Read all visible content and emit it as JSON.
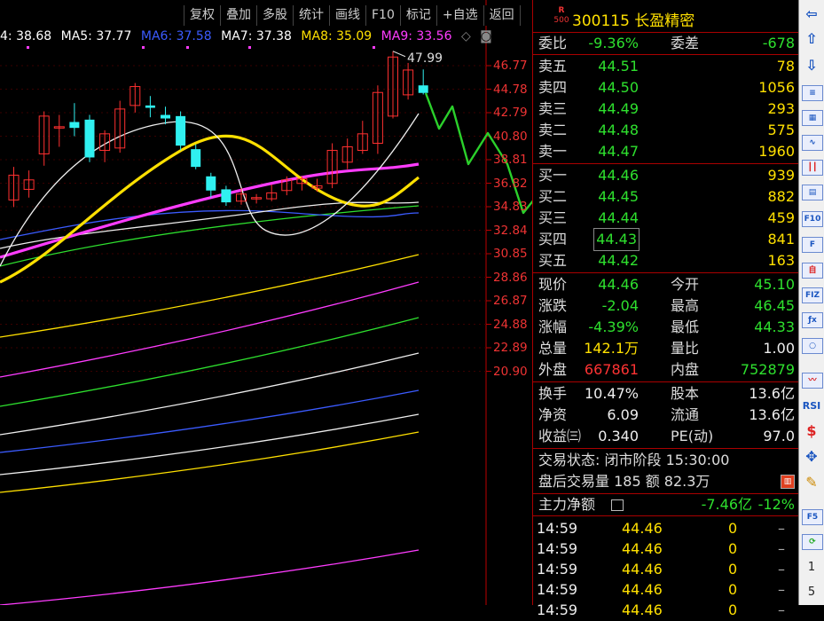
{
  "toolbar": [
    "复权",
    "叠加",
    "多股",
    "统计",
    "画线",
    "F10",
    "标记",
    "+自选",
    "返回"
  ],
  "ma_legend": [
    {
      "label": "4: 38.68",
      "color": "#ffffff"
    },
    {
      "label": "MA5: 37.77",
      "color": "#ffffff"
    },
    {
      "label": "MA6: 37.58",
      "color": "#3b5bff"
    },
    {
      "label": "MA7: 37.38",
      "color": "#ffffff"
    },
    {
      "label": "MA8: 35.09",
      "color": "#ffe000"
    },
    {
      "label": "MA9: 33.56",
      "color": "#ff3cff"
    }
  ],
  "price_axis": [
    "46.77",
    "44.78",
    "42.79",
    "40.80",
    "38.81",
    "36.82",
    "34.83",
    "32.84",
    "30.85",
    "28.86",
    "26.87",
    "24.88",
    "22.89",
    "20.90"
  ],
  "peak_label": "47.99",
  "chart_data": {
    "type": "candlestick",
    "ylim": [
      20.9,
      46.77
    ],
    "candles": [
      {
        "o": 35.4,
        "c": 37.5,
        "h": 38.2,
        "l": 34.8
      },
      {
        "o": 36.3,
        "c": 37.1,
        "h": 37.9,
        "l": 35.6
      },
      {
        "o": 39.3,
        "c": 42.5,
        "h": 42.9,
        "l": 38.3
      },
      {
        "o": 41.6,
        "c": 41.6,
        "h": 42.6,
        "l": 39.9
      },
      {
        "o": 42.0,
        "c": 41.5,
        "h": 43.6,
        "l": 40.8
      },
      {
        "o": 42.2,
        "c": 39.0,
        "h": 42.6,
        "l": 38.6
      },
      {
        "o": 39.6,
        "c": 41.0,
        "h": 41.3,
        "l": 38.6
      },
      {
        "o": 39.8,
        "c": 43.1,
        "h": 43.8,
        "l": 39.4
      },
      {
        "o": 43.4,
        "c": 45.0,
        "h": 45.3,
        "l": 42.8
      },
      {
        "o": 43.4,
        "c": 43.2,
        "h": 44.2,
        "l": 42.4
      },
      {
        "o": 42.6,
        "c": 42.3,
        "h": 43.3,
        "l": 41.8
      },
      {
        "o": 42.5,
        "c": 40.0,
        "h": 42.9,
        "l": 39.6
      },
      {
        "o": 39.7,
        "c": 38.2,
        "h": 40.1,
        "l": 38.0
      },
      {
        "o": 37.4,
        "c": 36.2,
        "h": 37.7,
        "l": 35.6
      },
      {
        "o": 36.3,
        "c": 35.2,
        "h": 36.6,
        "l": 34.9
      },
      {
        "o": 35.3,
        "c": 35.9,
        "h": 36.4,
        "l": 35.0
      },
      {
        "o": 35.6,
        "c": 35.6,
        "h": 35.9,
        "l": 35.1
      },
      {
        "o": 35.5,
        "c": 36.0,
        "h": 36.7,
        "l": 35.3
      },
      {
        "o": 36.2,
        "c": 37.1,
        "h": 37.4,
        "l": 35.8
      },
      {
        "o": 36.8,
        "c": 37.2,
        "h": 37.4,
        "l": 36.2
      },
      {
        "o": 36.4,
        "c": 36.6,
        "h": 37.2,
        "l": 36.1
      },
      {
        "o": 36.8,
        "c": 39.6,
        "h": 40.2,
        "l": 36.4
      },
      {
        "o": 38.6,
        "c": 39.9,
        "h": 40.6,
        "l": 38.0
      },
      {
        "o": 39.6,
        "c": 41.0,
        "h": 42.1,
        "l": 39.3
      },
      {
        "o": 40.2,
        "c": 44.5,
        "h": 45.1,
        "l": 39.3
      },
      {
        "o": 42.5,
        "c": 47.5,
        "h": 47.99,
        "l": 42.3
      },
      {
        "o": 44.3,
        "c": 46.4,
        "h": 47.0,
        "l": 43.9
      },
      {
        "o": 45.1,
        "c": 44.46,
        "h": 46.45,
        "l": 44.33
      }
    ]
  },
  "stock": {
    "market_badge": "R",
    "market_num": "500",
    "code_name": "300115 长盈精密"
  },
  "weibi": {
    "label": "委比",
    "value": "-9.36%",
    "label2": "委差",
    "value2": "-678"
  },
  "sells": [
    {
      "label": "卖五",
      "price": "44.51",
      "vol": "78"
    },
    {
      "label": "卖四",
      "price": "44.50",
      "vol": "1056"
    },
    {
      "label": "卖三",
      "price": "44.49",
      "vol": "293"
    },
    {
      "label": "卖二",
      "price": "44.48",
      "vol": "575"
    },
    {
      "label": "卖一",
      "price": "44.47",
      "vol": "1960"
    }
  ],
  "buys": [
    {
      "label": "买一",
      "price": "44.46",
      "vol": "939"
    },
    {
      "label": "买二",
      "price": "44.45",
      "vol": "882"
    },
    {
      "label": "买三",
      "price": "44.44",
      "vol": "459"
    },
    {
      "label": "买四",
      "price": "44.43",
      "vol": "841"
    },
    {
      "label": "买五",
      "price": "44.42",
      "vol": "163"
    }
  ],
  "quote": {
    "xianjia": {
      "label": "现价",
      "value": "44.46",
      "label2": "今开",
      "value2": "45.10"
    },
    "zhangdie": {
      "label": "涨跌",
      "value": "-2.04",
      "label2": "最高",
      "value2": "46.45"
    },
    "zhangfu": {
      "label": "涨幅",
      "value": "-4.39%",
      "label2": "最低",
      "value2": "44.33"
    },
    "zongliang": {
      "label": "总量",
      "value": "142.1万",
      "label2": "量比",
      "value2": "1.00"
    },
    "waipan": {
      "label": "外盘",
      "value": "667861",
      "label2": "内盘",
      "value2": "752879"
    }
  },
  "fundamentals": {
    "huanshou": {
      "label": "换手",
      "value": "10.47%",
      "label2": "股本",
      "value2": "13.6亿"
    },
    "jingzi": {
      "label": "净资",
      "value": "6.09",
      "label2": "流通",
      "value2": "13.6亿"
    },
    "shouyi": {
      "label": "收益㈢",
      "value": "0.340",
      "label2": "PE(动)",
      "value2": "97.0"
    }
  },
  "trade_state": {
    "line1": "交易状态: 闭市阶段 15:30:00",
    "line2": "盘后交易量 185 额 82.3万"
  },
  "main_flow": {
    "label": "主力净额",
    "value": "-7.46亿",
    "pct": "-12%"
  },
  "trades": [
    {
      "time": "14:59",
      "price": "44.46",
      "vol": "0",
      "dir": "–"
    },
    {
      "time": "14:59",
      "price": "44.46",
      "vol": "0",
      "dir": "–"
    },
    {
      "time": "14:59",
      "price": "44.46",
      "vol": "0",
      "dir": "–"
    },
    {
      "time": "14:59",
      "price": "44.46",
      "vol": "0",
      "dir": "–"
    },
    {
      "time": "14:59",
      "price": "44.46",
      "vol": "0",
      "dir": "–"
    }
  ],
  "side_icons": [
    "arrow-left-icon",
    "arrow-up-icon",
    "arrow-down-icon",
    "list-icon",
    "grid-icon",
    "chart-line-icon",
    "candle-icon",
    "table-icon",
    "f10-icon",
    "f-icon",
    "self-icon",
    "fiz-icon",
    "fx-icon",
    "circle-icon",
    "wave-icon",
    "rsi-icon",
    "dollar-icon",
    "move-icon",
    "pen-icon",
    "f5-icon",
    "refresh-icon",
    "one-icon",
    "five-icon"
  ],
  "side_text": {
    "rsi": "RSI",
    "f5": "F5",
    "one": "1",
    "five": "5",
    "f10": "F10",
    "fiz": "FIZ"
  }
}
